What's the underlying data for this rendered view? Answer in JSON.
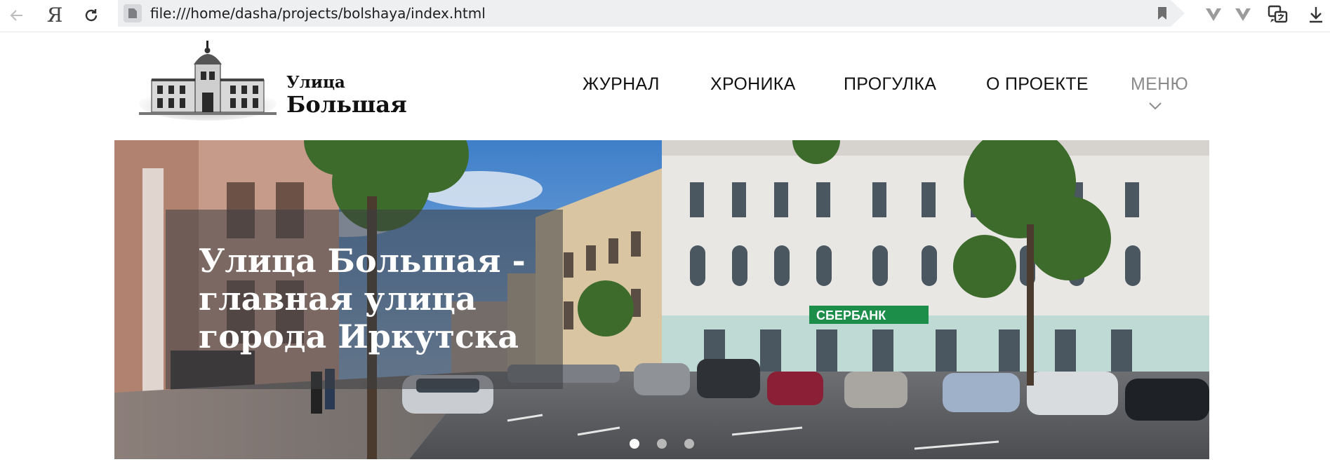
{
  "browser": {
    "url": "file:///home/dasha/projects/bolshaya/index.html",
    "yandex_glyph": "Я",
    "icons": [
      "back-arrow-icon",
      "yandex-icon",
      "reload-icon",
      "file-icon",
      "bookmark-icon",
      "extension-icon",
      "extension-icon",
      "translate-icon",
      "download-icon"
    ]
  },
  "site": {
    "title_line1": "Улица",
    "title_line2": "Большая",
    "nav": [
      {
        "label": "ЖУРНАЛ"
      },
      {
        "label": "ХРОНИКА"
      },
      {
        "label": "ПРОГУЛКА"
      },
      {
        "label": "О ПРОЕКТЕ"
      },
      {
        "label": "МЕНЮ"
      }
    ]
  },
  "hero": {
    "caption_line1": "Улица Большая -",
    "caption_line2": "главная улица",
    "caption_line3": "города Иркутска",
    "bank_sign": "СБЕРБАНК",
    "slide_count": 3,
    "active_slide": 1
  },
  "colors": {
    "nav_text": "#111111",
    "nav_menu": "#8a8a8a",
    "caption_overlay": "rgba(60,62,66,0.55)",
    "dot_active": "#ffffff",
    "dot_inactive": "#b8b8b8"
  }
}
